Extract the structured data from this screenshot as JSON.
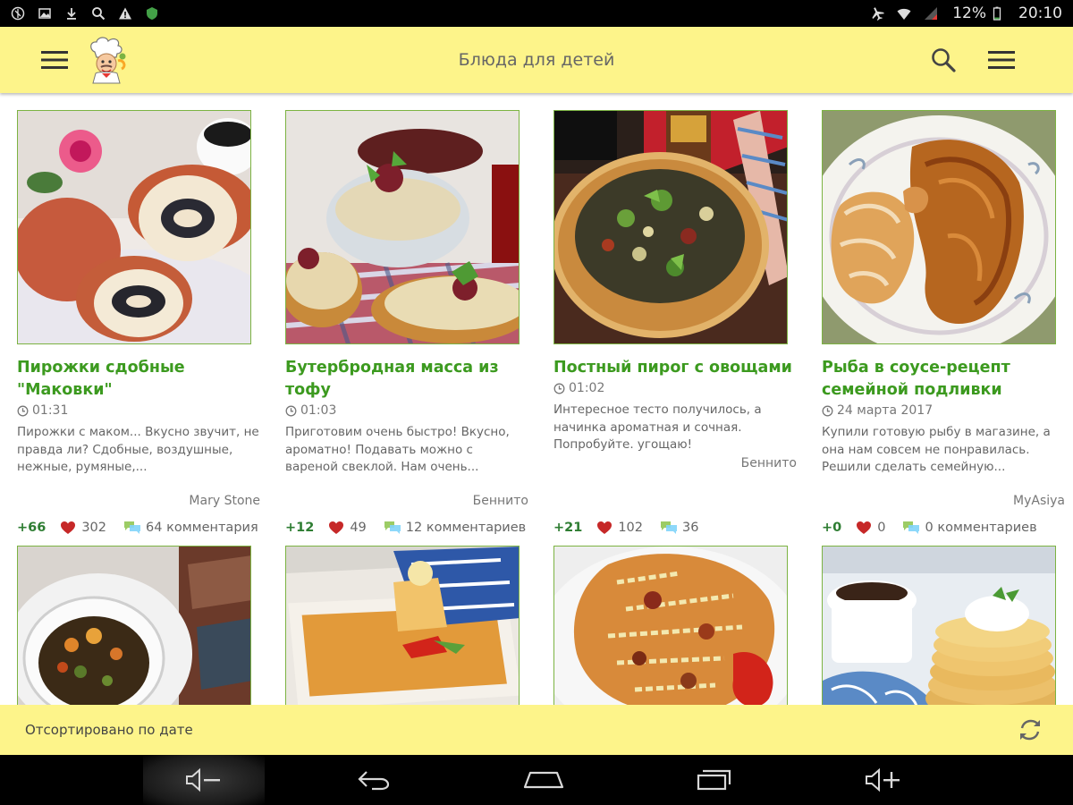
{
  "status_bar": {
    "battery": "12%",
    "time": "20:10"
  },
  "app_bar": {
    "title": "Блюда для детей",
    "logo": "chef-logo"
  },
  "recipes": [
    {
      "title": "Пирожки сдобные \"Маковки\"",
      "time": "01:31",
      "excerpt": "Пирожки с маком... Вкусно звучит, не правда ли? Сдобные, воздушные, нежные, румяные,...",
      "author": "Mary Stone",
      "score": "+66",
      "likes": "302",
      "comments": "64 комментария"
    },
    {
      "title": "Бутербродная масса из тофу",
      "time": "01:03",
      "excerpt": "Приготовим очень быстро! Вкусно, ароматно! Подавать можно с вареной свеклой. Нам очень...",
      "author": "Беннито",
      "score": "+12",
      "likes": "49",
      "comments": "12 комментариев"
    },
    {
      "title": "Постный пирог с овощами",
      "time": "01:02",
      "excerpt": "Интересное тесто получилось, а начинка ароматная и сочная. Попробуйте. угощаю!",
      "author": "Беннито",
      "score": "+21",
      "likes": "102",
      "comments": "36"
    },
    {
      "title": "Рыба в соусе-рецепт семейной подливки",
      "time": "24 марта 2017",
      "excerpt": "Купили готовую рыбу в магазине, а она нам совсем не понравилась. Решили сделать семейную...",
      "author": "MyAsiya",
      "score": "+0",
      "likes": "0",
      "comments": "0 комментариев"
    }
  ],
  "sort_bar": {
    "label": "Отсортировано по дате"
  },
  "colors": {
    "accent_yellow": "#fdf48a",
    "title_green": "#3c9a1f",
    "score_green": "#2e7d32",
    "heart_red": "#c62828"
  },
  "icons": [
    "menu-icon",
    "search-icon",
    "overflow-menu-icon",
    "clock-icon",
    "heart-icon",
    "comments-icon",
    "refresh-icon",
    "volume-down-icon",
    "back-icon",
    "home-icon",
    "recents-icon",
    "volume-up-icon"
  ]
}
